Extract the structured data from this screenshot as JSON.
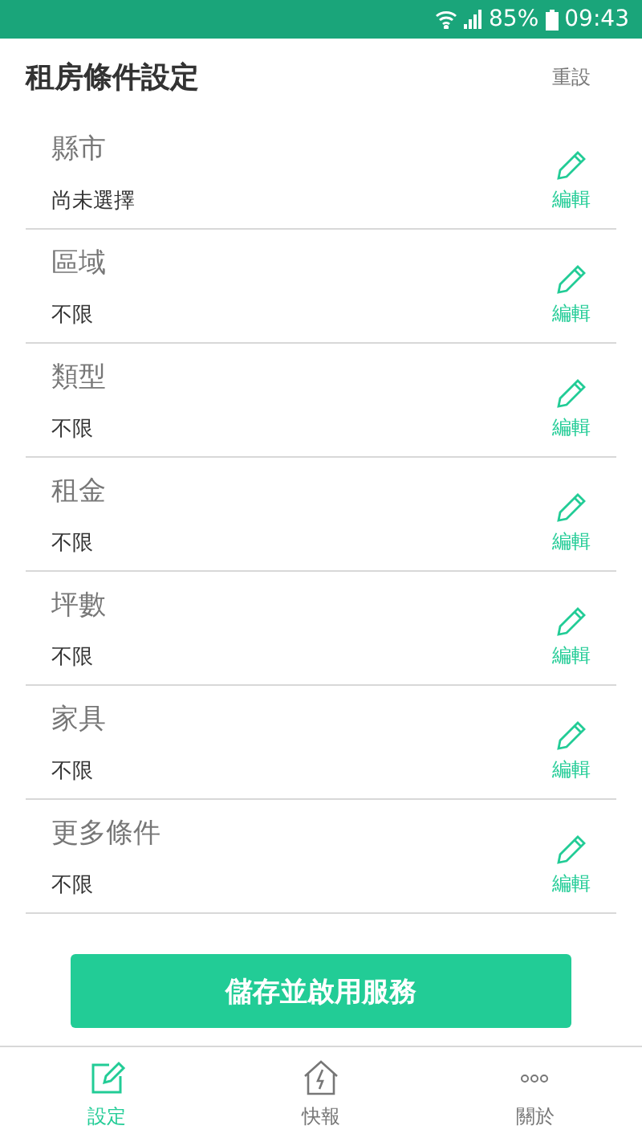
{
  "status_bar": {
    "battery": "85%",
    "time": "09:43"
  },
  "header": {
    "title": "租房條件設定",
    "reset": "重設"
  },
  "criteria": [
    {
      "label": "縣市",
      "value": "尚未選擇",
      "action": "編輯"
    },
    {
      "label": "區域",
      "value": "不限",
      "action": "編輯"
    },
    {
      "label": "類型",
      "value": "不限",
      "action": "編輯"
    },
    {
      "label": "租金",
      "value": "不限",
      "action": "編輯"
    },
    {
      "label": "坪數",
      "value": "不限",
      "action": "編輯"
    },
    {
      "label": "家具",
      "value": "不限",
      "action": "編輯"
    },
    {
      "label": "更多條件",
      "value": "不限",
      "action": "編輯"
    }
  ],
  "save_button": "儲存並啟用服務",
  "bottom_nav": [
    {
      "kind": "settings",
      "label": "設定",
      "selected": true
    },
    {
      "kind": "alerts",
      "label": "快報",
      "selected": false
    },
    {
      "kind": "about",
      "label": "關於",
      "selected": false
    }
  ]
}
